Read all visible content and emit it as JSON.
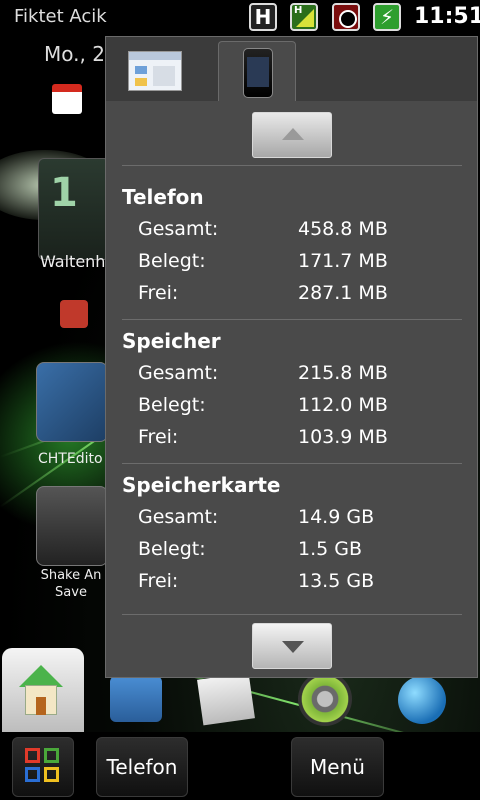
{
  "status_bar": {
    "network_label": "H",
    "signal_label": "H",
    "time": "11:51"
  },
  "home": {
    "line1": "Fiktet Acik",
    "line2": "Mo., 2",
    "clock_digit": "1",
    "weather_label": "Waltenh",
    "app1_label": "CHTEdito",
    "app2_label": "Shake An Save"
  },
  "softbar": {
    "telefon": "Telefon",
    "menu": "Menü"
  },
  "panel": {
    "sections": [
      {
        "title": "Telefon",
        "rows": [
          {
            "label": "Gesamt:",
            "value": "458.8 MB"
          },
          {
            "label": "Belegt:",
            "value": "171.7 MB"
          },
          {
            "label": "Frei:",
            "value": "287.1 MB"
          }
        ]
      },
      {
        "title": "Speicher",
        "rows": [
          {
            "label": "Gesamt:",
            "value": "215.8 MB"
          },
          {
            "label": "Belegt:",
            "value": "112.0 MB"
          },
          {
            "label": "Frei:",
            "value": "103.9 MB"
          }
        ]
      },
      {
        "title": "Speicherkarte",
        "rows": [
          {
            "label": "Gesamt:",
            "value": "14.9 GB"
          },
          {
            "label": "Belegt:",
            "value": "1.5 GB"
          },
          {
            "label": "Frei:",
            "value": "13.5 GB"
          }
        ]
      }
    ]
  },
  "icons": {
    "tab1": "programs-list-icon",
    "tab2": "phone-device-icon",
    "scroll_up": "chevron-up-icon",
    "scroll_down": "chevron-down-icon"
  }
}
